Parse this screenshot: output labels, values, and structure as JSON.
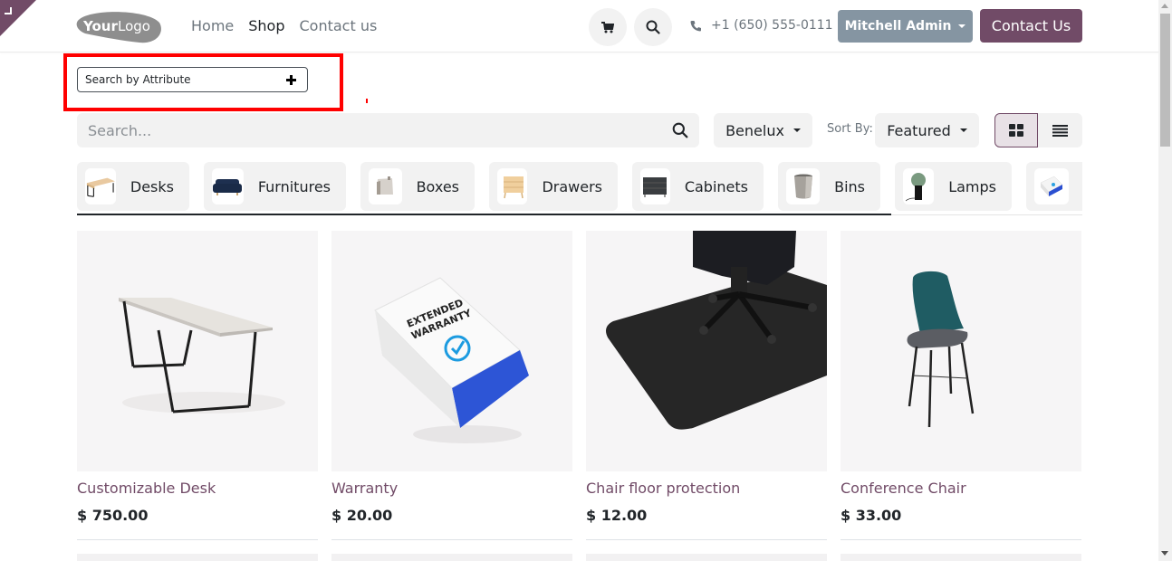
{
  "header": {
    "logo_text_bold": "Your",
    "logo_text_light": "Logo",
    "nav": [
      {
        "label": "Home",
        "active": false
      },
      {
        "label": "Shop",
        "active": true
      },
      {
        "label": "Contact us",
        "active": false
      }
    ],
    "phone": "+1 (650) 555-0111",
    "user_label": "Mitchell Admin",
    "contact_button": "Contact Us"
  },
  "attribute_search": {
    "label": "Search by Attribute",
    "icon": "plus-icon"
  },
  "toolbar": {
    "search_placeholder": "Search...",
    "search_value": "",
    "pricelist": "Benelux",
    "sort_label": "Sort By:",
    "sort_value": "Featured",
    "view_modes": [
      "grid",
      "list"
    ],
    "active_view": "grid"
  },
  "categories": [
    {
      "label": "Desks"
    },
    {
      "label": "Furnitures"
    },
    {
      "label": "Boxes"
    },
    {
      "label": "Drawers"
    },
    {
      "label": "Cabinets"
    },
    {
      "label": "Bins"
    },
    {
      "label": "Lamps"
    },
    {
      "label": ""
    }
  ],
  "products": [
    {
      "name": "Customizable Desk",
      "price": "$ 750.00"
    },
    {
      "name": "Warranty",
      "price": "$ 20.00"
    },
    {
      "name": "Chair floor protection",
      "price": "$ 12.00"
    },
    {
      "name": "Conference Chair",
      "price": "$ 33.00"
    }
  ],
  "colors": {
    "brand": "#714b67",
    "user_button": "#8595a2",
    "highlight": "#ff0000",
    "pill_bg": "#f2f2f2"
  }
}
